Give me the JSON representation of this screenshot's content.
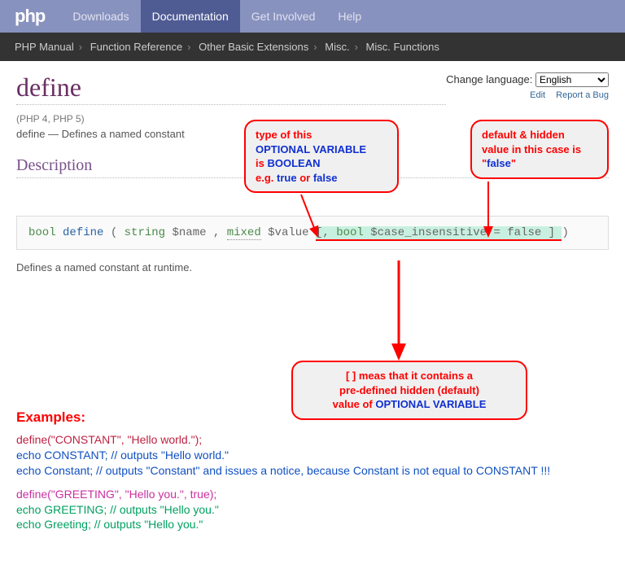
{
  "nav": {
    "logo": "php",
    "items": [
      "Downloads",
      "Documentation",
      "Get Involved",
      "Help"
    ],
    "active": 1
  },
  "breadcrumb": [
    "PHP Manual",
    "Function Reference",
    "Other Basic Extensions",
    "Misc.",
    "Misc. Functions"
  ],
  "lang": {
    "label": "Change language:",
    "value": "English",
    "links": {
      "edit": "Edit",
      "bug": "Report a Bug"
    }
  },
  "page": {
    "title": "define",
    "versions": "(PHP 4, PHP 5)",
    "purpose_fn": "define",
    "purpose_sep": " — ",
    "purpose_txt": "Defines a named constant",
    "section": "Description",
    "desc": "Defines a named constant at runtime."
  },
  "sig": {
    "ret": "bool",
    "fn": "define",
    "p1_t": "string",
    "p1_n": "$name",
    "p2_t": "mixed",
    "p2_n": "$value",
    "opt_open": "[,",
    "p3_t": "bool",
    "p3_n": "$case_insensitive",
    "p3_eq": "= false",
    "opt_close": "]"
  },
  "callouts": {
    "c1_l1": "type of this",
    "c1_l2": "OPTIONAL VARIABLE",
    "c1_l3a": "is ",
    "c1_l3b": "BOOLEAN",
    "c1_l4a": "e.g. ",
    "c1_l4b": "true",
    "c1_l4c": " or ",
    "c1_l4d": "false",
    "c2_l1": "default & hidden",
    "c2_l2": "value in this case is",
    "c2_l3a": "\"",
    "c2_l3b": "false",
    "c2_l3c": "\"",
    "c3_l1a": "[ ]",
    "c3_l1b": " meas that it contains a",
    "c3_l2": "pre-defined hidden (default)",
    "c3_l3a": "value of  ",
    "c3_l3b": "OPTIONAL VARIABLE"
  },
  "examples": {
    "title": "Examples:",
    "l1": "define(\"CONSTANT\", \"Hello world.\");",
    "l2": "echo CONSTANT; // outputs \"Hello world.\"",
    "l3": "echo Constant; // outputs \"Constant\" and issues a notice, because Constant is not equal to CONSTANT !!!",
    "l4": "define(\"GREETING\", \"Hello you.\", true);",
    "l5": "echo GREETING; // outputs \"Hello you.\"",
    "l6": "echo Greeting; // outputs \"Hello you.\""
  }
}
